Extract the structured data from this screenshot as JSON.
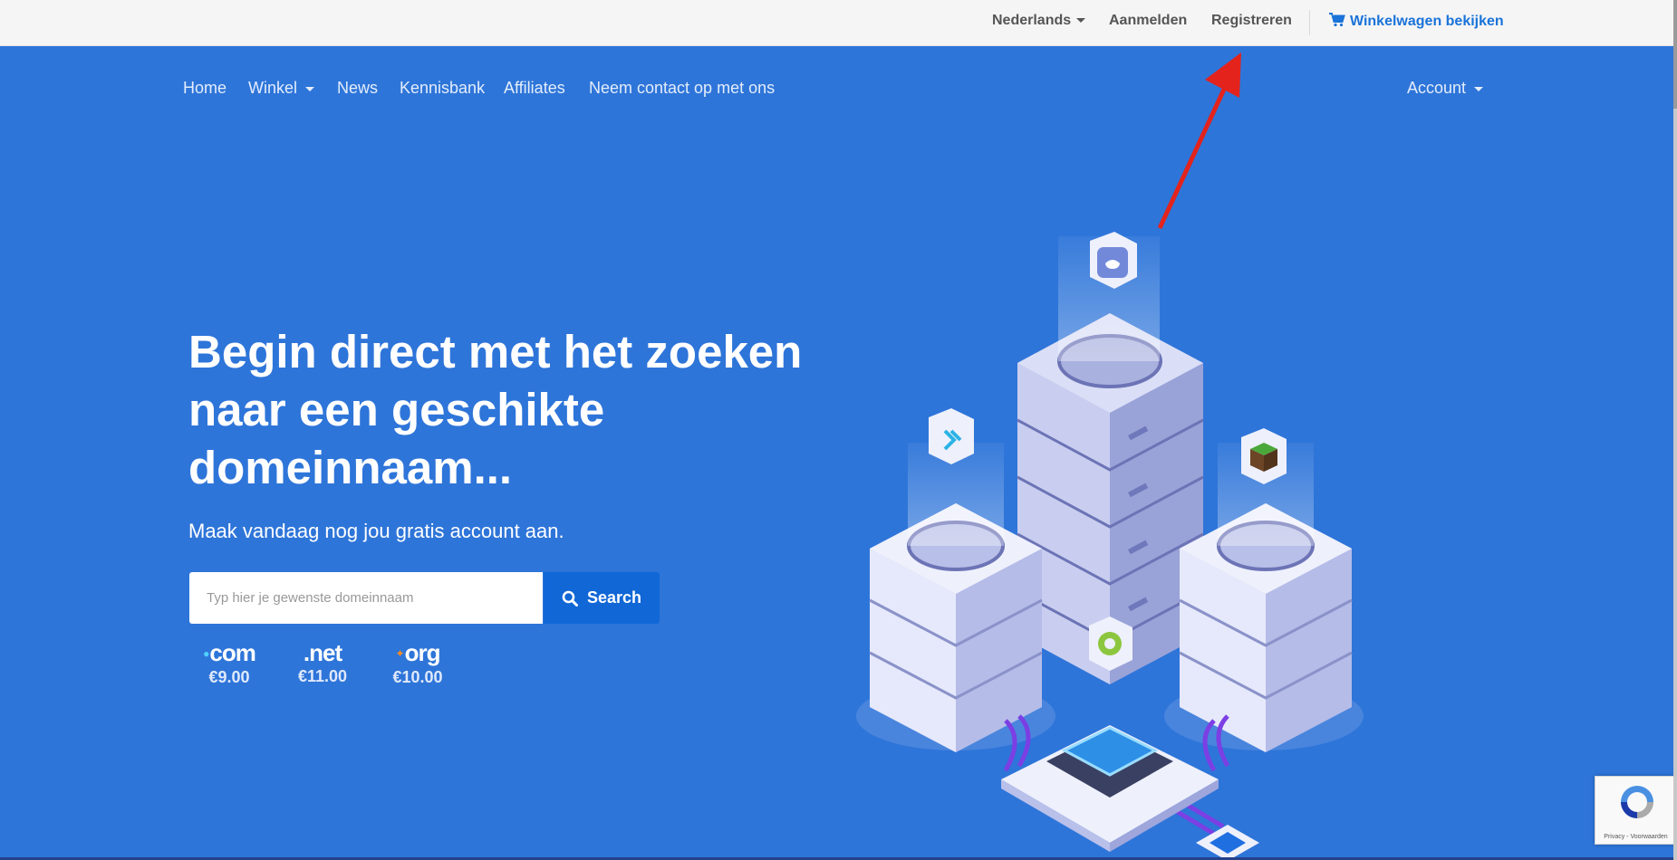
{
  "topbar": {
    "language": "Nederlands",
    "login": "Aanmelden",
    "register": "Registreren",
    "cart": "Winkelwagen bekijken"
  },
  "nav": {
    "items": [
      {
        "label": "Home",
        "dropdown": false
      },
      {
        "label": "Winkel",
        "dropdown": true
      },
      {
        "label": "News",
        "dropdown": false
      },
      {
        "label": "Kennisbank",
        "dropdown": false
      },
      {
        "label": "Affiliates",
        "dropdown": false
      },
      {
        "label": "Neem contact op met ons",
        "dropdown": false
      }
    ],
    "account": "Account"
  },
  "hero": {
    "headline": "Begin direct met het zoeken naar een geschikte domeinnaam...",
    "subline": "Maak vandaag nog jou gratis account aan.",
    "search_placeholder": "Typ hier je gewenste domeinnaam",
    "search_button": "Search",
    "tlds": [
      {
        "name": "com",
        "price": "€9.00",
        "dot_color": "#4fd1ff"
      },
      {
        "name": ".net",
        "price": "€11.00",
        "dot_color": "#ffb300"
      },
      {
        "name": "org",
        "price": "€10.00",
        "dot_color": "#ff8c1a"
      }
    ]
  },
  "recaptcha": {
    "text": "Privacy - Voorwaarden"
  },
  "colors": {
    "hero_bg": "#2e75d9",
    "search_button": "#1167d6",
    "cart_link": "#1a73d9",
    "annotation_arrow": "#e3231c"
  },
  "icons": [
    "caret-down-icon",
    "cart-icon",
    "search-icon",
    "discord-icon",
    "jira-icon",
    "minecraft-icon",
    "gear-icon",
    "recaptcha-icon"
  ]
}
